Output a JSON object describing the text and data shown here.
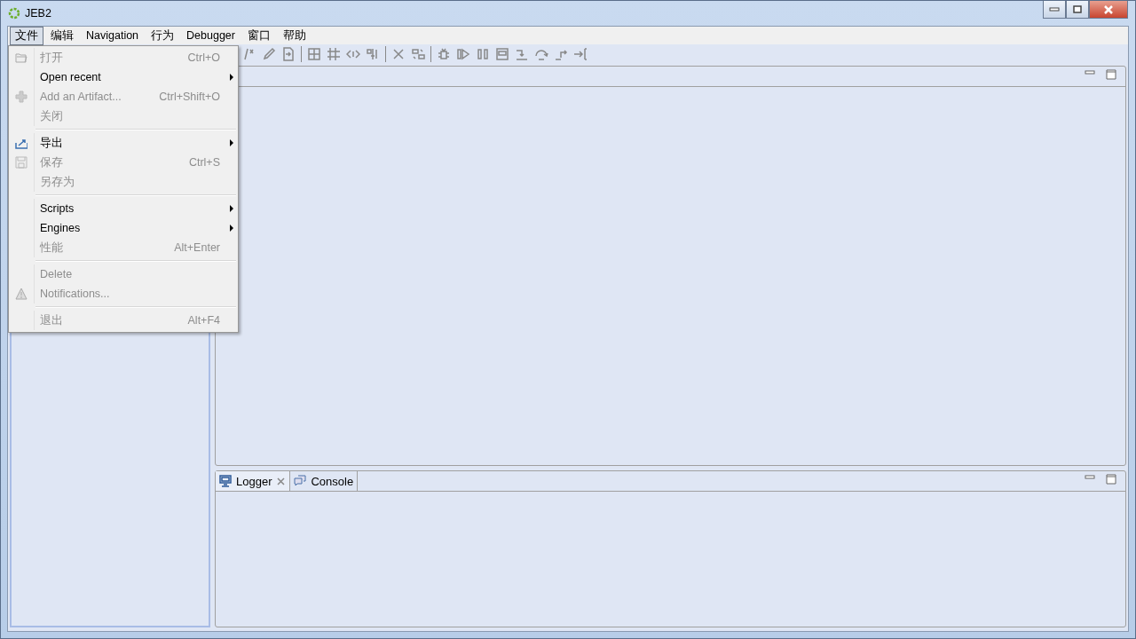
{
  "window": {
    "title": "JEB2"
  },
  "menubar": [
    {
      "label": "文件",
      "selected": true
    },
    {
      "label": "编辑",
      "selected": false
    },
    {
      "label": "Navigation",
      "selected": false
    },
    {
      "label": "行为",
      "selected": false
    },
    {
      "label": "Debugger",
      "selected": false
    },
    {
      "label": "窗口",
      "selected": false
    },
    {
      "label": "帮助",
      "selected": false
    }
  ],
  "file_menu": [
    {
      "kind": "item",
      "label": "打开",
      "shortcut": "Ctrl+O",
      "disabled": true,
      "submenu": false
    },
    {
      "kind": "item",
      "label": "Open recent",
      "disabled": false,
      "submenu": true
    },
    {
      "kind": "item",
      "label": "Add an Artifact...",
      "shortcut": "Ctrl+Shift+O",
      "disabled": true,
      "submenu": false
    },
    {
      "kind": "item",
      "label": "关闭",
      "disabled": true,
      "submenu": false
    },
    {
      "kind": "separator"
    },
    {
      "kind": "item",
      "label": "导出",
      "disabled": false,
      "submenu": true
    },
    {
      "kind": "item",
      "label": "保存",
      "shortcut": "Ctrl+S",
      "disabled": true,
      "submenu": false
    },
    {
      "kind": "item",
      "label": "另存为",
      "disabled": true,
      "submenu": false
    },
    {
      "kind": "separator"
    },
    {
      "kind": "item",
      "label": "Scripts",
      "disabled": false,
      "submenu": true
    },
    {
      "kind": "item",
      "label": "Engines",
      "disabled": false,
      "submenu": true
    },
    {
      "kind": "item",
      "label": "性能",
      "shortcut": "Alt+Enter",
      "disabled": true,
      "submenu": false
    },
    {
      "kind": "separator"
    },
    {
      "kind": "item",
      "label": "Delete",
      "disabled": true,
      "submenu": false
    },
    {
      "kind": "item",
      "label": "Notifications...",
      "disabled": true,
      "submenu": false
    },
    {
      "kind": "separator"
    },
    {
      "kind": "item",
      "label": "退出",
      "shortcut": "Alt+F4",
      "disabled": true,
      "submenu": false
    }
  ],
  "bottom_tabs": [
    {
      "label": "Logger",
      "selected": true
    },
    {
      "label": "Console",
      "selected": false
    }
  ]
}
